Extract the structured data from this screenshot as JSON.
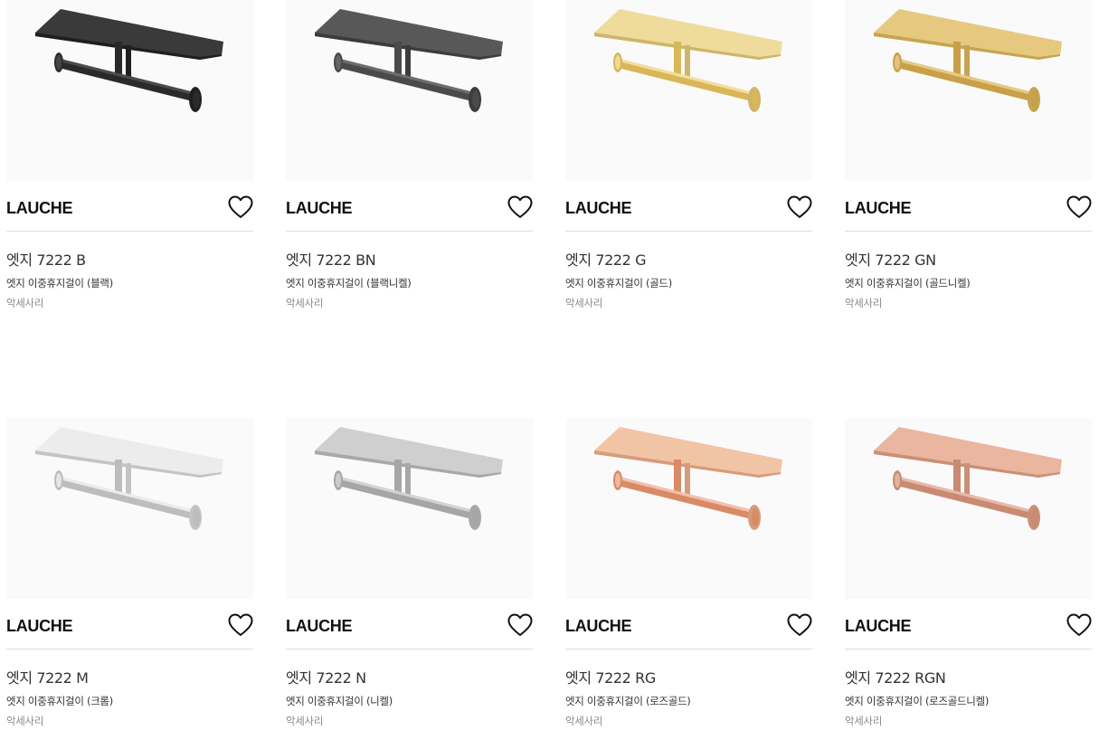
{
  "products": [
    {
      "brand": "LAUCHE",
      "name": "엣지 7222 B",
      "desc": "엣지 이중휴지걸이 (블랙)",
      "category": "악세사리",
      "finish": {
        "shelf": "#3a3a3a",
        "shelfEdge": "#1f1f1f",
        "bar": "#2a2a2a",
        "barHi": "#5a5a5a"
      }
    },
    {
      "brand": "LAUCHE",
      "name": "엣지 7222 BN",
      "desc": "엣지 이중휴지걸이 (블랙니켈)",
      "category": "악세사리",
      "finish": {
        "shelf": "#585858",
        "shelfEdge": "#3c3c3c",
        "bar": "#4a4a4a",
        "barHi": "#7a7a7a"
      }
    },
    {
      "brand": "LAUCHE",
      "name": "엣지 7222 G",
      "desc": "엣지 이중휴지걸이 (골드)",
      "category": "악세사리",
      "finish": {
        "shelf": "#efdc9c",
        "shelfEdge": "#cdb56a",
        "bar": "#d8b65a",
        "barHi": "#fff0b8"
      }
    },
    {
      "brand": "LAUCHE",
      "name": "엣지 7222 GN",
      "desc": "엣지 이중휴지걸이 (골드니켈)",
      "category": "악세사리",
      "finish": {
        "shelf": "#e6c97e",
        "shelfEdge": "#c6a552",
        "bar": "#c9a04a",
        "barHi": "#f2dc9c"
      }
    },
    {
      "brand": "LAUCHE",
      "name": "엣지 7222 M",
      "desc": "엣지 이중휴지걸이 (크롬)",
      "category": "악세사리",
      "finish": {
        "shelf": "#ececec",
        "shelfEdge": "#c4c4c4",
        "bar": "#bdbdbd",
        "barHi": "#ffffff"
      }
    },
    {
      "brand": "LAUCHE",
      "name": "엣지 7222 N",
      "desc": "엣지 이중휴지걸이 (니켈)",
      "category": "악세사리",
      "finish": {
        "shelf": "#cfcfcf",
        "shelfEdge": "#a8a8a8",
        "bar": "#a6a6a6",
        "barHi": "#e6e6e6"
      }
    },
    {
      "brand": "LAUCHE",
      "name": "엣지 7222 RG",
      "desc": "엣지 이중휴지걸이 (로즈골드)",
      "category": "악세사리",
      "finish": {
        "shelf": "#f2c4a6",
        "shelfEdge": "#d59c7c",
        "bar": "#d98a66",
        "barHi": "#ffd9c4"
      }
    },
    {
      "brand": "LAUCHE",
      "name": "엣지 7222 RGN",
      "desc": "엣지 이중휴지걸이 (로즈골드니켈)",
      "category": "악세사리",
      "finish": {
        "shelf": "#eab6a0",
        "shelfEdge": "#c99078",
        "bar": "#c98a72",
        "barHi": "#f4cdbd"
      }
    }
  ],
  "icons": {
    "wishlist": "heart-outline-icon"
  }
}
